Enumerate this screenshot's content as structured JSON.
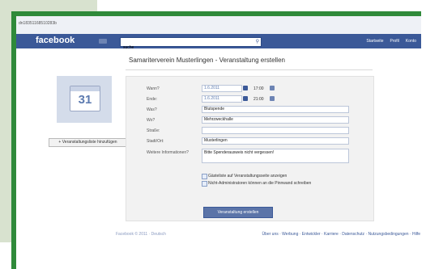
{
  "browser": {
    "url": "dn18351168510283b"
  },
  "facebook": {
    "logo": "facebook",
    "search_value": "suche",
    "nav": [
      "Startseite",
      "Profil",
      "Konto"
    ]
  },
  "event": {
    "calendar_day": "31",
    "add_to_list_label": "+ Veranstaltungsliste hinzufügen",
    "page_title": "Samariterverein Musterlingen - Veranstaltung erstellen",
    "labels": {
      "wann": "Wann?",
      "ende": "Ende:",
      "was": "Was?",
      "wo": "Wo?",
      "strasse": "Straße:",
      "stadt": "Stadt/Ort:",
      "info": "Weitere Informationen?"
    },
    "start_date": "1.6.2011",
    "start_time": "17:00",
    "end_date": "1.6.2011",
    "end_time": "21:00",
    "was": "Blutspende",
    "wo": "Mehrzweckhalle",
    "strasse": "",
    "stadt": "Musterlingen",
    "info": "Bitte Spenderausweis nicht vergessen!",
    "checkbox1": "Gästeliste auf Veranstaltungsseite anzeigen",
    "checkbox2": "Nicht-Administratoren können an die Pinnwand schreiben",
    "submit_label": "Veranstaltung erstellen"
  },
  "footer": {
    "left": "Facebook © 2011 · Deutsch",
    "right": "Über uns · Werbung · Entwickler · Karriere · Datenschutz · Nutzungsbedingungen · Hilfe"
  }
}
